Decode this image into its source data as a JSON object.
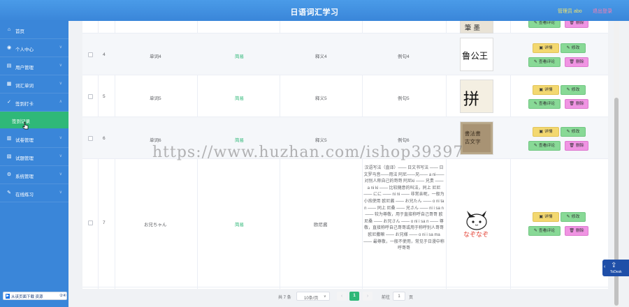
{
  "header": {
    "title": "日语词汇学习",
    "user": "管理员 abo",
    "logout": "退出登录"
  },
  "sidebar": {
    "items": [
      {
        "label": "首页",
        "icon": "home-icon",
        "glyph": "⌂"
      },
      {
        "label": "个人中心",
        "icon": "user-icon",
        "glyph": "◉"
      },
      {
        "label": "用户管理",
        "icon": "users-icon",
        "glyph": "▤"
      },
      {
        "label": "词汇单词",
        "icon": "book-icon",
        "glyph": "▦"
      },
      {
        "label": "签到打卡",
        "icon": "checkin-icon",
        "glyph": "✓"
      },
      {
        "label": "试卷管理",
        "icon": "paper-icon",
        "glyph": "▥"
      },
      {
        "label": "试题管理",
        "icon": "question-icon",
        "glyph": "▧"
      },
      {
        "label": "系统管理",
        "icon": "settings-icon",
        "glyph": "⚙"
      },
      {
        "label": "在线练习",
        "icon": "practice-icon",
        "glyph": "✎"
      }
    ],
    "submenu_active": "签到记录"
  },
  "taskbar": {
    "label": "从该页面下载 资源",
    "extra": "②④"
  },
  "table": {
    "actions": {
      "detail": "详情",
      "edit": "修改",
      "review": "查看评论",
      "delete": "删除"
    },
    "rows": [
      {
        "index": "4",
        "word": "单词4",
        "status": "简易",
        "meaning": "释义4",
        "example": "例句4",
        "image": "calligraphy-4"
      },
      {
        "index": "5",
        "word": "单词5",
        "status": "简易",
        "meaning": "释义5",
        "example": "例句5",
        "image": "calligraphy-5"
      },
      {
        "index": "6",
        "word": "单词6",
        "status": "简易",
        "meaning": "释义5",
        "example": "例句6",
        "image": "calligraphy-6"
      },
      {
        "index": "7",
        "word": "お兄ちゃん",
        "status": "简易",
        "meaning": "欧尼酱",
        "example": "汉语写法（直译）—— 日文书写法 —— 日文罗马音——用法 阿尼——兄—— a ni—— 对别人称自己的哥哥 阿尼ki —— 兄贵 —— a ni ki —— 比较随意的叫法，同上 尼尼 —— にに —— ni ni —— 非常亲昵，一般为小孩使用 欧尼酱 —— お兄たん —— o ni ta n —— 同上 尼桑 —— 兄さん —— ni i sa n —— 较为尊敬，用于直接称呼自己哥哥 欧尼桑 —— お兄さん —— o ni i sa n —— 尊敬，直接称呼自己哥哥或用于称呼别人哥哥 欧尼撒嘛 —— お兄様 —— o ni i sa ma —— 最尊敬，一般不使用，常见于日漫中称呼哥哥",
        "image": "cat-mascot",
        "image_caption": "なぞなぞ"
      }
    ]
  },
  "pagination": {
    "total": "共 7 条",
    "page_size": "10条/页",
    "current": "1",
    "goto_label": "前往",
    "goto_value": "1",
    "unit": "页",
    "prev": "‹",
    "next": "›"
  },
  "todesk": {
    "label": "ToDesk"
  },
  "watermark": "https://www.huzhan.com/ishop39397",
  "colors": {
    "header": "#4a9be8",
    "sidebar": "#3a86d9",
    "active": "#2fb878",
    "detail": "#f3d870",
    "edit": "#88d996",
    "delete": "#f094e3"
  }
}
